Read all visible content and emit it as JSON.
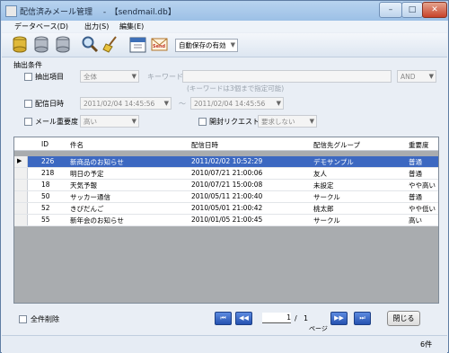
{
  "window": {
    "title": "配信済みメール管理 　-　【sendmail.db】",
    "minimize": "–",
    "maximize": "□",
    "close": "✕"
  },
  "menu": [
    "データベース(D)",
    "出力(S)",
    "編集(E)"
  ],
  "toolbar": {
    "icons": [
      "database-icon",
      "database-icon",
      "database-icon",
      "magnifier-icon",
      "broom-icon",
      "calendar-icon",
      "send-icon"
    ],
    "send_label": "Send",
    "autosave_value": "自動保存の有効"
  },
  "filter": {
    "section_title": "抽出条件",
    "item_label": "抽出項目",
    "item_value": "全体",
    "keyword_label": "キーワード",
    "keyword_value": "",
    "keyword_hint": "(キーワードは3個まで指定可能)",
    "logic_value": "AND",
    "date_label": "配信日時",
    "date_from": "2011/02/04 14:45:56",
    "tilde": "～",
    "date_to": "2011/02/04 14:45:56",
    "importance_label": "メール重要度",
    "importance_value": "高い",
    "request_label": "開封リクエスト要求",
    "request_value": "要求しない"
  },
  "table": {
    "columns": [
      "ID",
      "件名",
      "配信日時",
      "配信先グループ",
      "重要度"
    ],
    "rows": [
      [
        "226",
        "新商品のお知らせ",
        "2011/02/02 10:52:29",
        "デモサンプル",
        "普通"
      ],
      [
        "218",
        "明日の予定",
        "2010/07/21 21:00:06",
        "友人",
        "普通"
      ],
      [
        "18",
        "天気予報",
        "2010/07/21 15:00:08",
        "未設定",
        "やや高い"
      ],
      [
        "50",
        "サッカー通信",
        "2010/05/11 21:00:40",
        "サークル",
        "普通"
      ],
      [
        "52",
        "きびだんご",
        "2010/05/01 21:00:42",
        "桃太郎",
        "やや低い"
      ],
      [
        "55",
        "新年会のお知らせ",
        "2010/01/05 21:00:45",
        "サークル",
        "高い"
      ]
    ],
    "selected_row": 0
  },
  "footer": {
    "delete_all_label": "全件削除",
    "nav_first": "⏮",
    "nav_prev": "◀◀",
    "nav_next": "▶▶",
    "nav_last": "⏭",
    "page_current": "1",
    "page_sep": "/",
    "page_total": "1",
    "page_label": "ページ",
    "close_label": "閉じる"
  },
  "status": {
    "count": "6件"
  },
  "colors": {
    "accent": "#3c68c1",
    "nav": "#2552b0"
  }
}
